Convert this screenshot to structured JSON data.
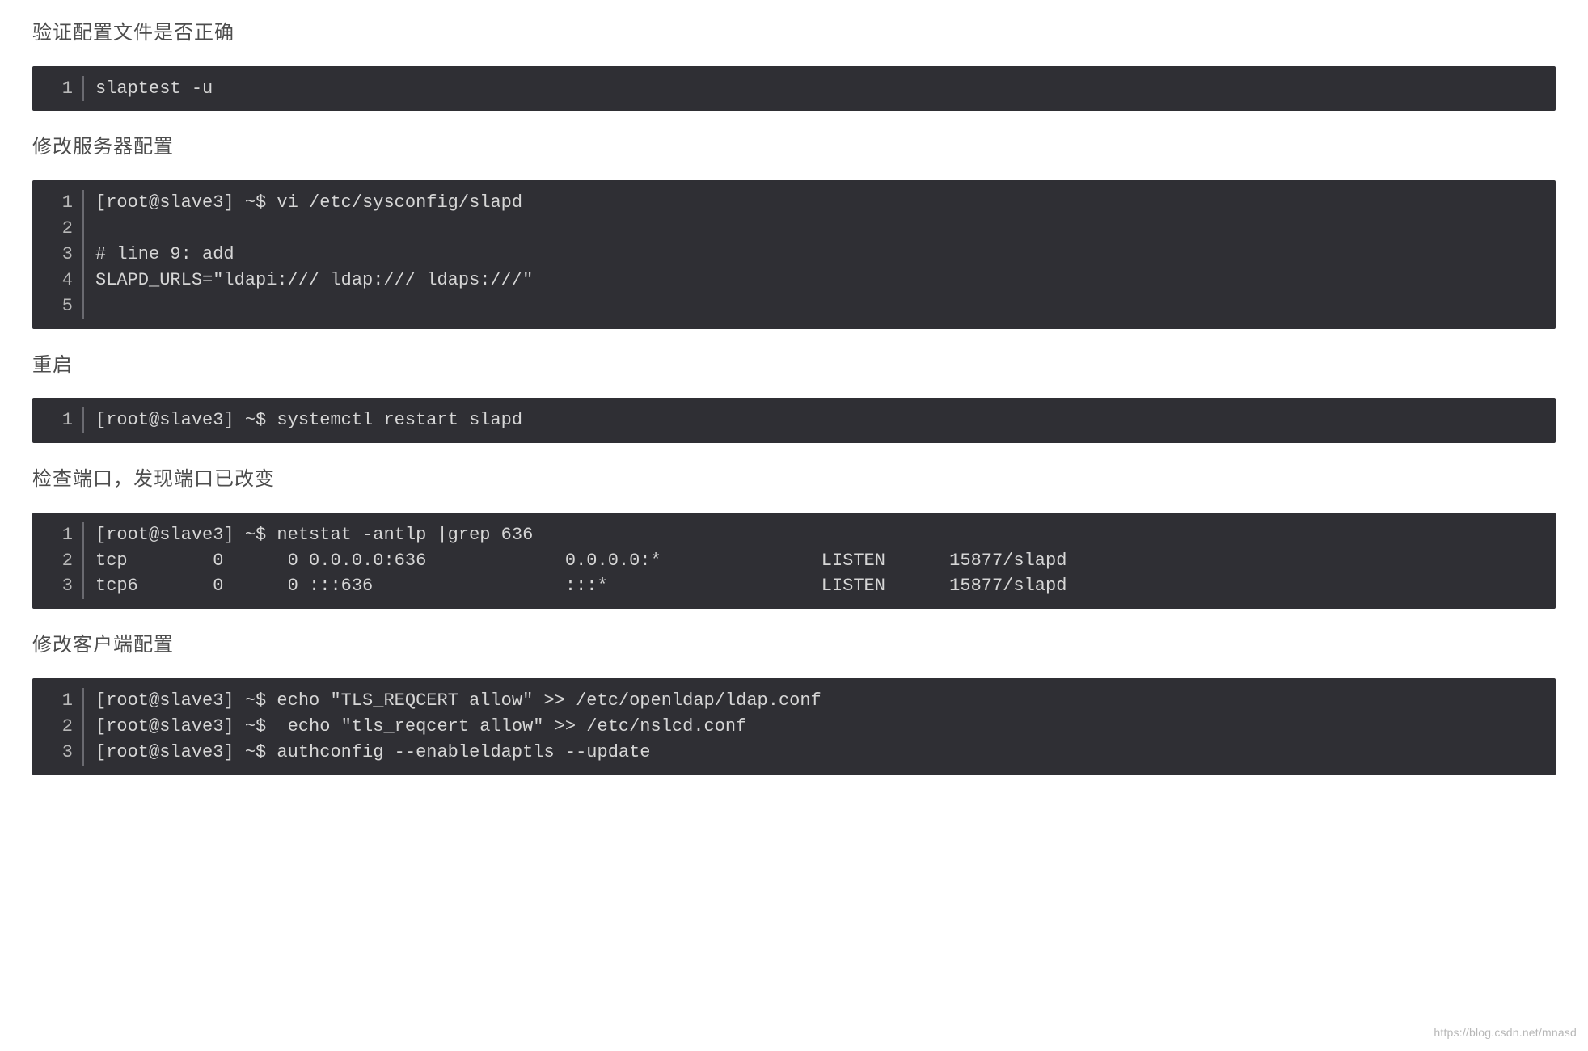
{
  "para1": "验证配置文件是否正确",
  "code1": {
    "lines": [
      "1"
    ],
    "text": "slaptest -u"
  },
  "para2": "修改服务器配置",
  "code2": {
    "lines": [
      "1",
      "2",
      "3",
      "4",
      "5"
    ],
    "text": "[root@slave3] ~$ vi /etc/sysconfig/slapd\n\n# line 9: add\nSLAPD_URLS=\"ldapi:/// ldap:/// ldaps:///\"\n"
  },
  "para3": "重启",
  "code3": {
    "lines": [
      "1"
    ],
    "text": "[root@slave3] ~$ systemctl restart slapd"
  },
  "para4": "检查端口，发现端口已改变",
  "code4": {
    "lines": [
      "1",
      "2",
      "3"
    ],
    "text": "[root@slave3] ~$ netstat -antlp |grep 636\ntcp        0      0 0.0.0.0:636             0.0.0.0:*               LISTEN      15877/slapd\ntcp6       0      0 :::636                  :::*                    LISTEN      15877/slapd"
  },
  "para5": "修改客户端配置",
  "code5": {
    "lines": [
      "1",
      "2",
      "3"
    ],
    "text": "[root@slave3] ~$ echo \"TLS_REQCERT allow\" >> /etc/openldap/ldap.conf\n[root@slave3] ~$  echo \"tls_reqcert allow\" >> /etc/nslcd.conf\n[root@slave3] ~$ authconfig --enableldaptls --update"
  },
  "watermark": "https://blog.csdn.net/mnasd"
}
